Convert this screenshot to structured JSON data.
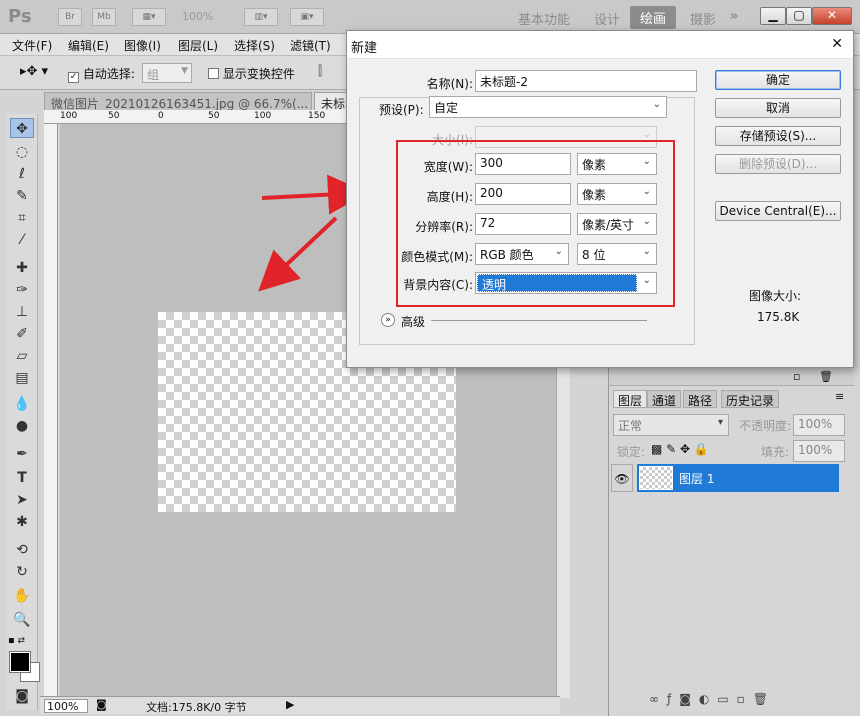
{
  "app": {
    "logo": "Ps",
    "toolbar_bridge": "Br",
    "toolbar_minibridge": "Mb",
    "zoom": "100%",
    "workspaces": [
      "基本功能",
      "设计",
      "绘画",
      "摄影"
    ],
    "more": "»"
  },
  "menubar": [
    "文件(F)",
    "编辑(E)",
    "图像(I)",
    "图层(L)",
    "选择(S)",
    "滤镜(T)"
  ],
  "options": {
    "auto_select_label": "自动选择:",
    "auto_select_value": "组",
    "show_transform_label": "显示变换控件"
  },
  "tabs": [
    "微信图片_20210126163451.jpg @ 66.7%(...",
    "未标"
  ],
  "ruler": [
    "100",
    "50",
    "0",
    "50",
    "100",
    "150"
  ],
  "status": {
    "zoom": "100%",
    "doc": "文档:175.8K/0 字节"
  },
  "dialog": {
    "title": "新建",
    "close": "✕",
    "name_label": "名称(N):",
    "name_value": "未标题-2",
    "preset_label": "预设(P):",
    "preset_value": "自定",
    "size_label": "大小(I):",
    "width_label": "宽度(W):",
    "width_value": "300",
    "width_unit": "像素",
    "height_label": "高度(H):",
    "height_value": "200",
    "height_unit": "像素",
    "resolution_label": "分辨率(R):",
    "resolution_value": "72",
    "resolution_unit": "像素/英寸",
    "color_mode_label": "颜色模式(M):",
    "color_mode_value": "RGB 颜色",
    "bit_depth": "8 位",
    "background_label": "背景内容(C):",
    "background_value": "透明",
    "advanced_label": "高级",
    "ok": "确定",
    "cancel": "取消",
    "save_preset": "存储预设(S)...",
    "delete_preset": "删除预设(D)...",
    "device_central": "Device Central(E)...",
    "image_size_label": "图像大小:",
    "image_size_value": "175.8K"
  },
  "layers_panel": {
    "tabs": [
      "图层",
      "通道",
      "路径",
      "历史记录"
    ],
    "blend_mode": "正常",
    "opacity_label": "不透明度:",
    "opacity_value": "100%",
    "lock_label": "锁定:",
    "fill_label": "填充:",
    "fill_value": "100%",
    "layer_name": "图层 1"
  },
  "colors": {
    "highlight": "#e0242a",
    "selection": "#1f7ad8"
  }
}
